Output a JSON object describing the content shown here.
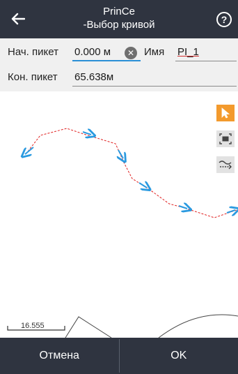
{
  "header": {
    "title": "PrinCe",
    "subtitle": "-Выбор кривой",
    "back_icon": "arrow-left-icon",
    "help_label": "?"
  },
  "form": {
    "start_label": "Нач. пикет",
    "start_value": "0.000",
    "start_unit": "м",
    "name_label": "Имя",
    "name_value": "PI_1",
    "end_label": "Кон. пикет",
    "end_value": "65.638м"
  },
  "tools": [
    {
      "name": "select-arrow-icon",
      "active": true
    },
    {
      "name": "zoom-extent-icon",
      "active": false
    },
    {
      "name": "curve-select-icon",
      "active": false
    }
  ],
  "map": {
    "scale_label": "16.555",
    "colors": {
      "route_line": "#e02020",
      "direction_arrow": "#2a9ae0"
    }
  },
  "footer": {
    "cancel_label": "Отмена",
    "ok_label": "OK"
  },
  "colors": {
    "bar": "#2f3440",
    "accent_orange": "#f39a2d",
    "focus_blue": "#2a8fd6"
  }
}
